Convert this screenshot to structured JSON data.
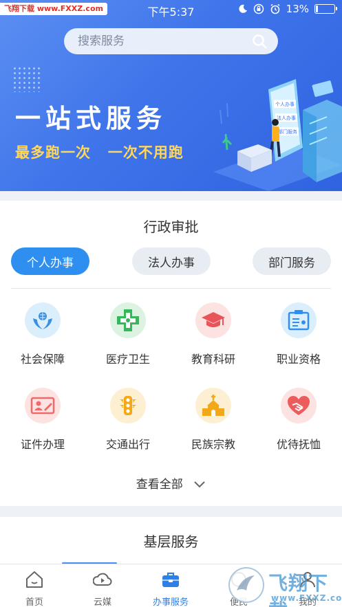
{
  "status_bar": {
    "watermark": "飞翔下载 www.FXXZ.com",
    "time": "下午5:37",
    "battery": "13%",
    "battery_level": 0.13
  },
  "search": {
    "placeholder": "搜索服务"
  },
  "banner": {
    "title": "一站式服务",
    "slogan": "最多跑一次   一次不用跑",
    "card_labels": [
      "个人办事",
      "法人办事",
      "部门服务"
    ]
  },
  "section_admin": {
    "title": "行政审批",
    "tabs": [
      {
        "label": "个人办事",
        "active": true
      },
      {
        "label": "法人办事",
        "active": false
      },
      {
        "label": "部门服务",
        "active": false
      }
    ],
    "items": [
      {
        "label": "社会保障",
        "icon": "social-security-icon",
        "color": "#3a8fe0"
      },
      {
        "label": "医疗卫生",
        "icon": "medical-cross-icon",
        "color": "#35b85a"
      },
      {
        "label": "教育科研",
        "icon": "graduation-cap-icon",
        "color": "#e8545a"
      },
      {
        "label": "职业资格",
        "icon": "certificate-icon",
        "color": "#2f8ff0"
      },
      {
        "label": "证件办理",
        "icon": "id-card-icon",
        "color": "#ee6a6a"
      },
      {
        "label": "交通出行",
        "icon": "traffic-light-icon",
        "color": "#f2a818"
      },
      {
        "label": "民族宗教",
        "icon": "temple-icon",
        "color": "#f2a818"
      },
      {
        "label": "优待抚恤",
        "icon": "heart-hand-icon",
        "color": "#ec5c5c"
      }
    ],
    "view_all": "查看全部"
  },
  "section_grassroots": {
    "title": "基层服务"
  },
  "bottom_nav": [
    {
      "label": "首页",
      "icon": "home-icon",
      "active": false
    },
    {
      "label": "云媒",
      "icon": "play-cloud-icon",
      "active": false
    },
    {
      "label": "办事服务",
      "icon": "briefcase-icon",
      "active": true
    },
    {
      "label": "便民",
      "icon": "convenience-icon",
      "active": false
    },
    {
      "label": "我的",
      "icon": "user-icon",
      "active": false
    }
  ],
  "watermark_br": {
    "text": "飞翔下载",
    "url": "www.FXXZ.com"
  },
  "colors": {
    "banner_blue": "#3f74ea",
    "accent_blue": "#2f8ff0",
    "slogan_yellow": "#ffd75a"
  }
}
